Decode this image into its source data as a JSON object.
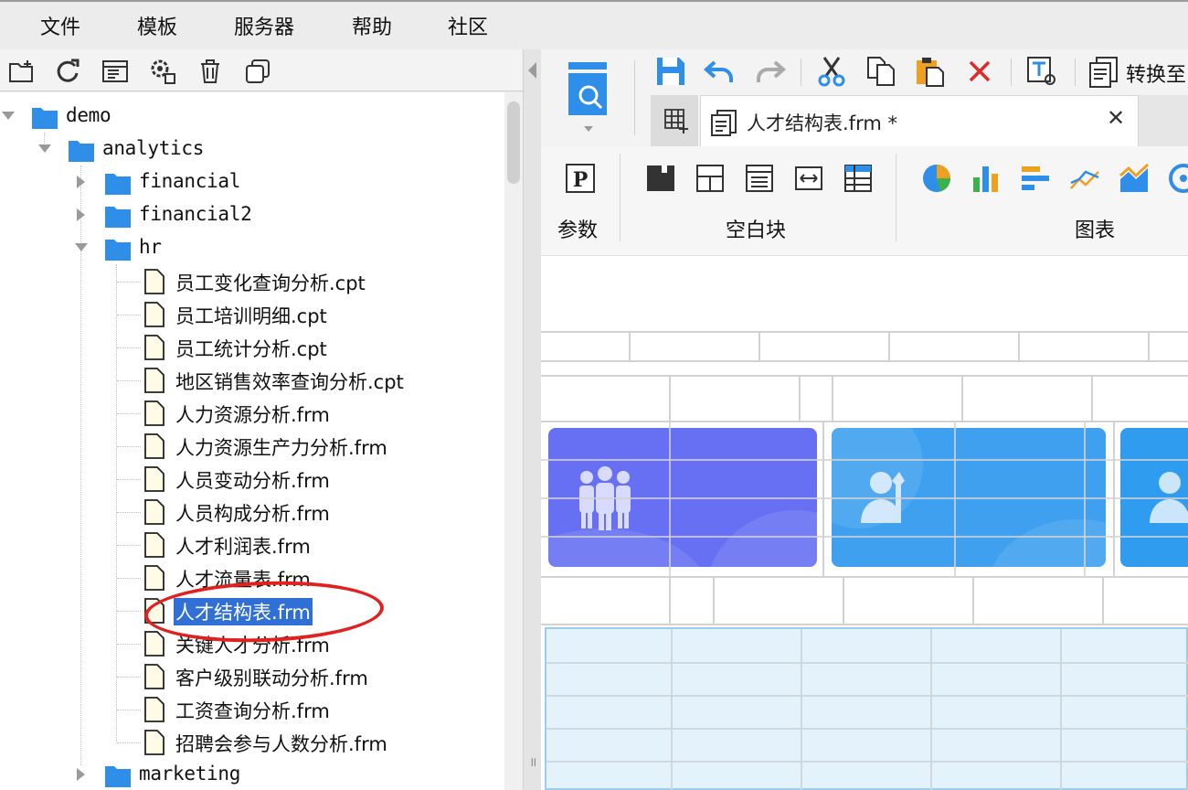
{
  "menu": [
    "文件",
    "模板",
    "服务器",
    "帮助",
    "社区"
  ],
  "left_toolbar": [
    "new-folder-icon",
    "refresh-icon",
    "template-list-icon",
    "settings-icon",
    "delete-icon",
    "copy-icon"
  ],
  "tree": {
    "root": "demo",
    "analytics": "analytics",
    "financial": "financial",
    "financial2": "financial2",
    "hr": "hr",
    "files": [
      "员工变化查询分析.cpt",
      "员工培训明细.cpt",
      "员工统计分析.cpt",
      "地区销售效率查询分析.cpt",
      "人力资源分析.frm",
      "人力资源生产力分析.frm",
      "人员变动分析.frm",
      "人员构成分析.frm",
      "人才利润表.frm",
      "人才流量表.frm",
      "人才结构表.frm",
      "关键人才分析.frm",
      "客户级别联动分析.frm",
      "工资查询分析.frm",
      "招聘会参与人数分析.frm"
    ],
    "selected_index": 10,
    "marketing": "marketing"
  },
  "toolbar": {
    "convert_label": "转换至"
  },
  "tab": {
    "title": "人才结构表.frm *",
    "close": "✕"
  },
  "widgets": {
    "param_label": "参数",
    "blank_label": "空白块",
    "chart_label": "图表",
    "param_letter": "P"
  },
  "colors": {
    "selected_bg": "#2f6fd6",
    "annotation": "#e0211e",
    "card1": "#6770f3",
    "card2": "#3ea0ef",
    "form_body": "#e3f2fb"
  }
}
